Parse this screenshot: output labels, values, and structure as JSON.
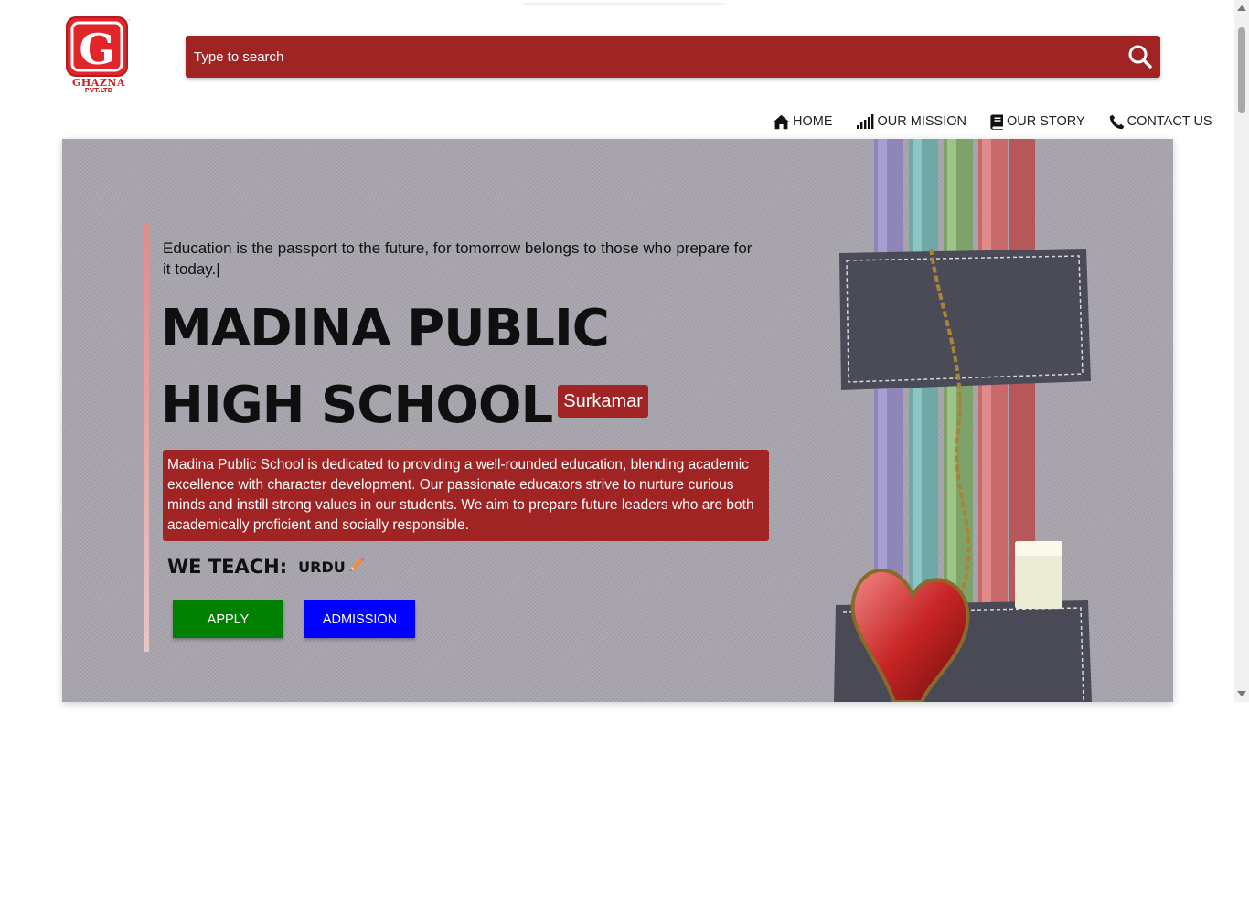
{
  "logo": {
    "brand": "GHAZNA",
    "sub": "PVT.LTD",
    "letter": "G"
  },
  "search": {
    "placeholder": "Type to search",
    "icon": "search-icon"
  },
  "nav": [
    {
      "label": "HOME",
      "icon": "home-icon"
    },
    {
      "label": "OUR MISSION",
      "icon": "signal-bars-icon"
    },
    {
      "label": "OUR STORY",
      "icon": "book-icon"
    },
    {
      "label": "CONTACT US",
      "icon": "phone-icon"
    }
  ],
  "hero": {
    "quote": "Education is the passport to the future, for tomorrow belongs to those who prepare for it today.|",
    "title": "MADINA PUBLIC HIGH SCHOOL",
    "location": "Surkamar",
    "description": "Madina Public School is dedicated to providing a well-rounded education, blending academic excellence with character development. Our passionate educators strive to nurture curious minds and instill strong values in our students. We aim to prepare future leaders who are both academically proficient and socially responsible.",
    "teach_label": "WE TEACH:",
    "teach_subject": "URDU",
    "buttons": {
      "apply": "APPLY",
      "admission": "ADMISSION"
    }
  },
  "colors": {
    "brand_red": "#a02424",
    "apply_green": "#008000",
    "admission_blue": "#0000ff",
    "hero_bg": "#a9a5ae"
  }
}
